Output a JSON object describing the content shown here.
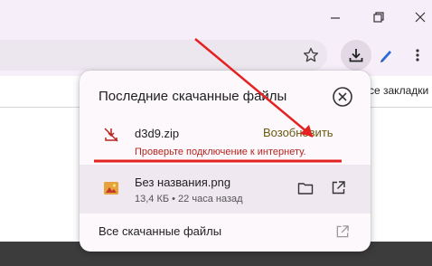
{
  "bookmarks_bar": {
    "label": "се закладки"
  },
  "downloads_popup": {
    "title": "Последние скачанные файлы",
    "items": [
      {
        "name": "d3d9.zip",
        "status": "Проверьте подключение к интернету.",
        "action": "Возобновить"
      },
      {
        "name": "Без названия.png",
        "meta": "13,4 КБ • 22 часа назад"
      }
    ],
    "all_downloads": "Все скачанные файлы"
  },
  "colors": {
    "accent": "#6a5a10",
    "error": "#b3261e",
    "annotation_red": "#e52222",
    "panel_bg": "#fcf8fc",
    "titlebar_bg": "#f6eef8"
  },
  "icons": [
    "minimize-icon",
    "restore-icon",
    "close-icon",
    "star-icon",
    "download-icon",
    "pen-icon",
    "kebab-menu-icon",
    "download-failed-icon",
    "image-file-icon",
    "folder-icon",
    "open-external-icon",
    "close-circle-icon"
  ]
}
